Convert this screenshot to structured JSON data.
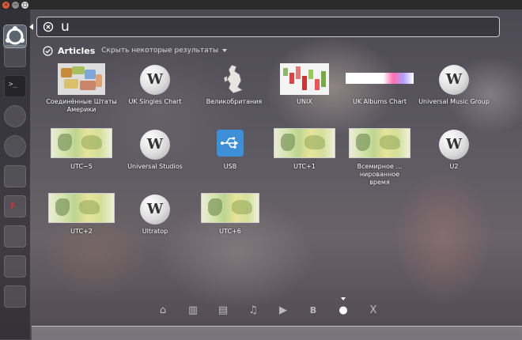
{
  "window_controls": {
    "close": "×",
    "min": "−",
    "max": "◻"
  },
  "search": {
    "value": "u",
    "placeholder": ""
  },
  "section": {
    "title": "Articles",
    "filter_label": "Скрыть некоторые результаты"
  },
  "results": [
    {
      "label": "Соединённые Штаты Америки",
      "icon": "us-map-thumbnail"
    },
    {
      "label": "UK Singles Chart",
      "icon": "wikipedia-globe-icon"
    },
    {
      "label": "Великобритания",
      "icon": "uk-map-thumbnail"
    },
    {
      "label": "UNIX",
      "icon": "unix-chart-thumbnail"
    },
    {
      "label": "UK Albums Chart",
      "icon": "uk-albums-thumbnail"
    },
    {
      "label": "Universal Music Group",
      "icon": "wikipedia-globe-icon"
    },
    {
      "label": "UTC−5",
      "icon": "timezone-map-thumbnail"
    },
    {
      "label": "Universal Studios",
      "icon": "wikipedia-globe-icon"
    },
    {
      "label": "USB",
      "icon": "usb-icon"
    },
    {
      "label": "UTC+1",
      "icon": "timezone-map-thumbnail"
    },
    {
      "label": "Всемирное …нированное время",
      "icon": "timezone-map-thumbnail"
    },
    {
      "label": "U2",
      "icon": "wikipedia-globe-icon"
    },
    {
      "label": "UTC+2",
      "icon": "timezone-map-thumbnail"
    },
    {
      "label": "Ultratop",
      "icon": "wikipedia-globe-icon"
    },
    {
      "label": "UTC+6",
      "icon": "timezone-map-thumbnail"
    }
  ],
  "lenses": [
    {
      "name": "home",
      "glyph": "⌂"
    },
    {
      "name": "applications",
      "glyph": "▥"
    },
    {
      "name": "files",
      "glyph": "▤"
    },
    {
      "name": "music",
      "glyph": "♫"
    },
    {
      "name": "video",
      "glyph": "▶"
    },
    {
      "name": "b",
      "glyph": "B"
    },
    {
      "name": "wikipedia",
      "glyph": "●",
      "active": true
    },
    {
      "name": "x",
      "glyph": "X"
    }
  ],
  "wiki_glyph": "W"
}
